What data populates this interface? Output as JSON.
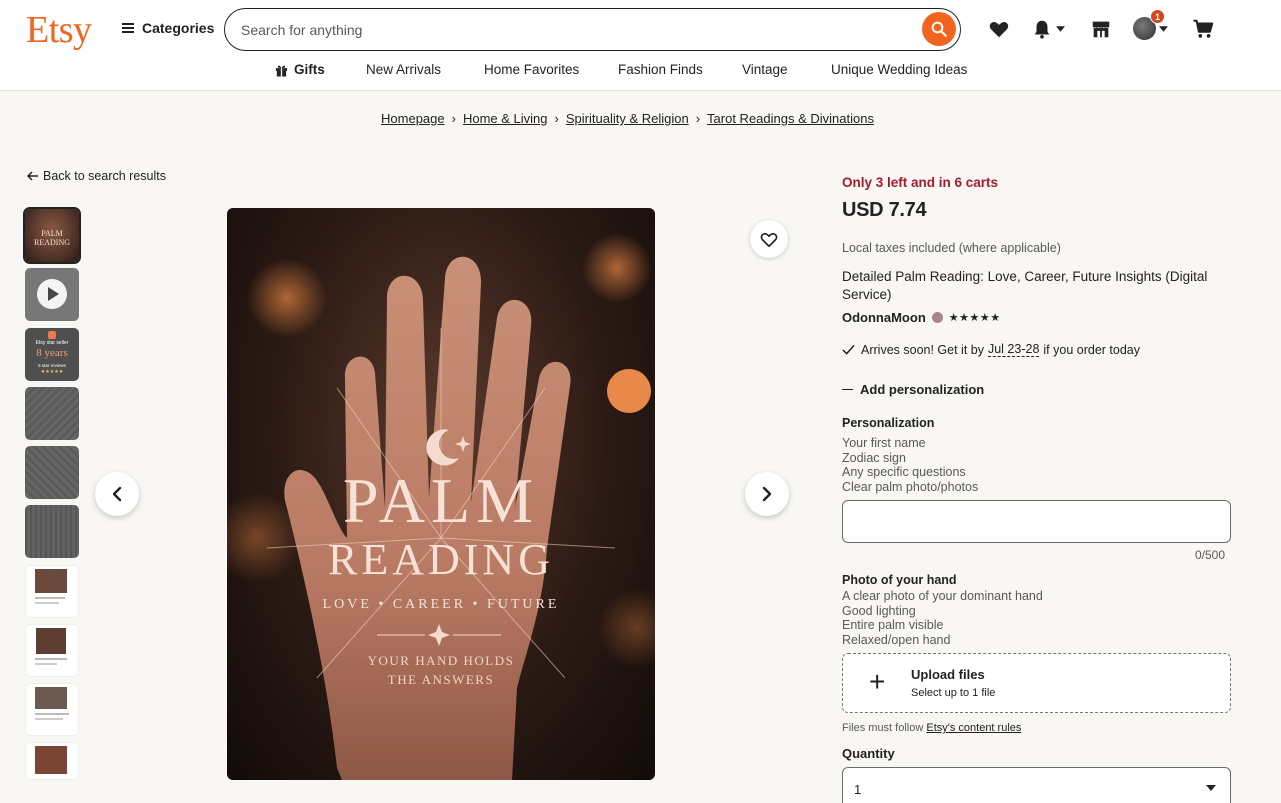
{
  "header": {
    "logo": "Etsy",
    "categories_label": "Categories",
    "search_placeholder": "Search for anything",
    "cart_badge": "1"
  },
  "nav": [
    {
      "label": "Gifts"
    },
    {
      "label": "New Arrivals"
    },
    {
      "label": "Home Favorites"
    },
    {
      "label": "Fashion Finds"
    },
    {
      "label": "Vintage"
    },
    {
      "label": "Unique Wedding Ideas"
    }
  ],
  "breadcrumb": [
    "Homepage",
    "Home & Living",
    "Spirituality & Religion",
    "Tarot Readings & Divinations"
  ],
  "back_label": "Back to search results",
  "thumbnail_texts": {
    "t1": "PALM READING",
    "t3_brand": "Etsy star seller",
    "t3_years": "8 years",
    "t3_sub": "5 star reviews"
  },
  "main_image": {
    "title_line1": "PALM",
    "title_line2": "READING",
    "subtitle": "LOVE • CAREER • FUTURE",
    "tagline1": "YOUR HAND HOLDS",
    "tagline2": "THE ANSWERS"
  },
  "product": {
    "stock": "Only 3 left and in 6 carts",
    "price": "USD 7.74",
    "tax_note": "Local taxes included (where applicable)",
    "title": "Detailed Palm Reading: Love, Career, Future Insights (Digital Service)",
    "shop_name": "OdonnaMoon",
    "stars": "★★★★★",
    "arrives_prefix": "Arrives soon! Get it by",
    "arrives_date": "Jul 23-28",
    "arrives_suffix": "if you order today",
    "add_personalization": "Add personalization",
    "personalization_title": "Personalization",
    "personalization_lines": [
      "Your first name",
      "Zodiac sign",
      "Any specific questions",
      "Clear palm photo/photos"
    ],
    "personalization_counter": "0/500",
    "photo_title": "Photo of your hand",
    "photo_lines": [
      "A clear photo of your dominant hand",
      "Good lighting",
      "Entire palm visible",
      "Relaxed/open hand"
    ],
    "upload_title": "Upload files",
    "upload_sub": "Select up to 1 file",
    "files_note_prefix": "Files must follow",
    "files_note_link": "Etsy's content rules",
    "quantity_label": "Quantity",
    "quantity_value": "1"
  },
  "colors": {
    "brand": "#f1641e",
    "stock_red": "#a61a2e"
  }
}
